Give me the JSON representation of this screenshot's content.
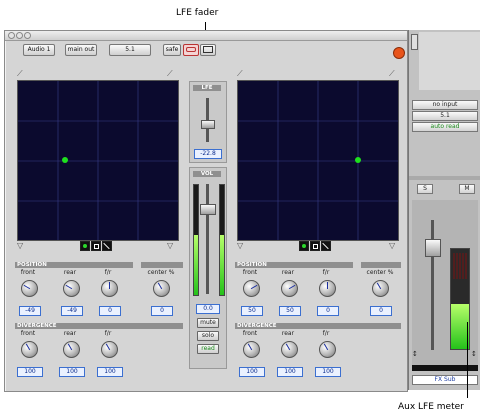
{
  "callouts": {
    "lfe_fader": "LFE fader",
    "aux_lfe_meter": "Aux LFE meter"
  },
  "toolbar": {
    "track": "Audio 1",
    "output": "main out",
    "format": "5.1",
    "safe": "safe"
  },
  "left_panel": {
    "position_header": "POSITION",
    "position_labels": [
      "front",
      "rear",
      "f/r",
      "center %"
    ],
    "position_values": [
      "-49",
      "-49",
      "0",
      "0"
    ],
    "divergence_header": "DIVERGENCE",
    "divergence_labels": [
      "front",
      "rear",
      "f/r"
    ],
    "divergence_values": [
      "100",
      "100",
      "100"
    ]
  },
  "right_panel": {
    "position_header": "POSITION",
    "position_labels": [
      "front",
      "rear",
      "f/r",
      "center %"
    ],
    "position_values": [
      "50",
      "50",
      "0",
      "0"
    ],
    "divergence_header": "DIVERGENCE",
    "divergence_labels": [
      "front",
      "rear",
      "f/r"
    ],
    "divergence_values": [
      "100",
      "100",
      "100"
    ]
  },
  "center": {
    "lfe_label": "LFE",
    "lfe_value": "-22.8",
    "vol_label": "VOL",
    "vol_value": "0.0",
    "mute": "mute",
    "solo": "solo",
    "read": "read"
  },
  "strip": {
    "input": "no input",
    "format": "5.1",
    "automation": "auto read",
    "s": "S",
    "m": "M",
    "name": "FX Sub"
  },
  "levels": {
    "center_meter_fill": 0.55,
    "aux_meter_fill": 0.45
  },
  "colors": {
    "pad_bg": "#0b0a2e",
    "puck": "#1ee01e",
    "meter_green": "#24c21a",
    "value_blue": "#0a2a8a",
    "close_button": "#e8541b"
  }
}
